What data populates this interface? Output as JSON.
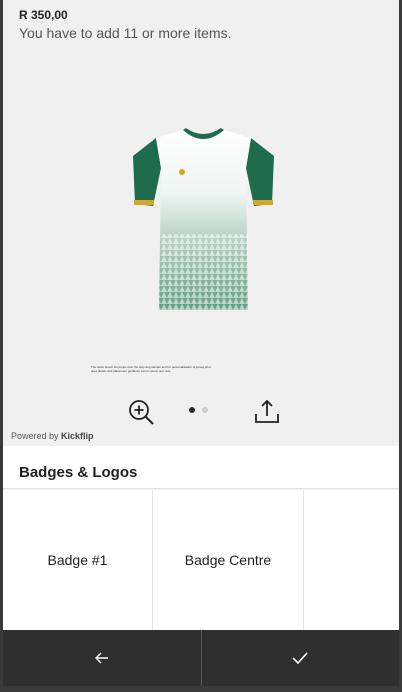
{
  "product": {
    "price": "R 350,00",
    "minimum_message": "You have to add 11 or more items."
  },
  "preview": {
    "fine_print": "The quick brown fox jumps over the lazy dog sample text for personalisation of jersey print area details and placement guidance Lorem ipsum text note",
    "zoom_icon": "zoom-in-icon",
    "share_icon": "share-icon",
    "carousel": {
      "count": 2,
      "active": 1
    },
    "powered_prefix": "Powered by ",
    "powered_brand": "Kickflip",
    "jersey_colors": {
      "body": "#ffffff",
      "pattern": "#2e7d5b",
      "sleeves": "#1f6b4e",
      "trim": "#d8a625"
    }
  },
  "section": {
    "title": "Badges & Logos"
  },
  "badges": [
    {
      "label": "Badge #1"
    },
    {
      "label": "Badge Centre"
    },
    {
      "label": ""
    }
  ],
  "actions": {
    "back_icon": "arrow-left-icon",
    "confirm_icon": "check-icon"
  }
}
